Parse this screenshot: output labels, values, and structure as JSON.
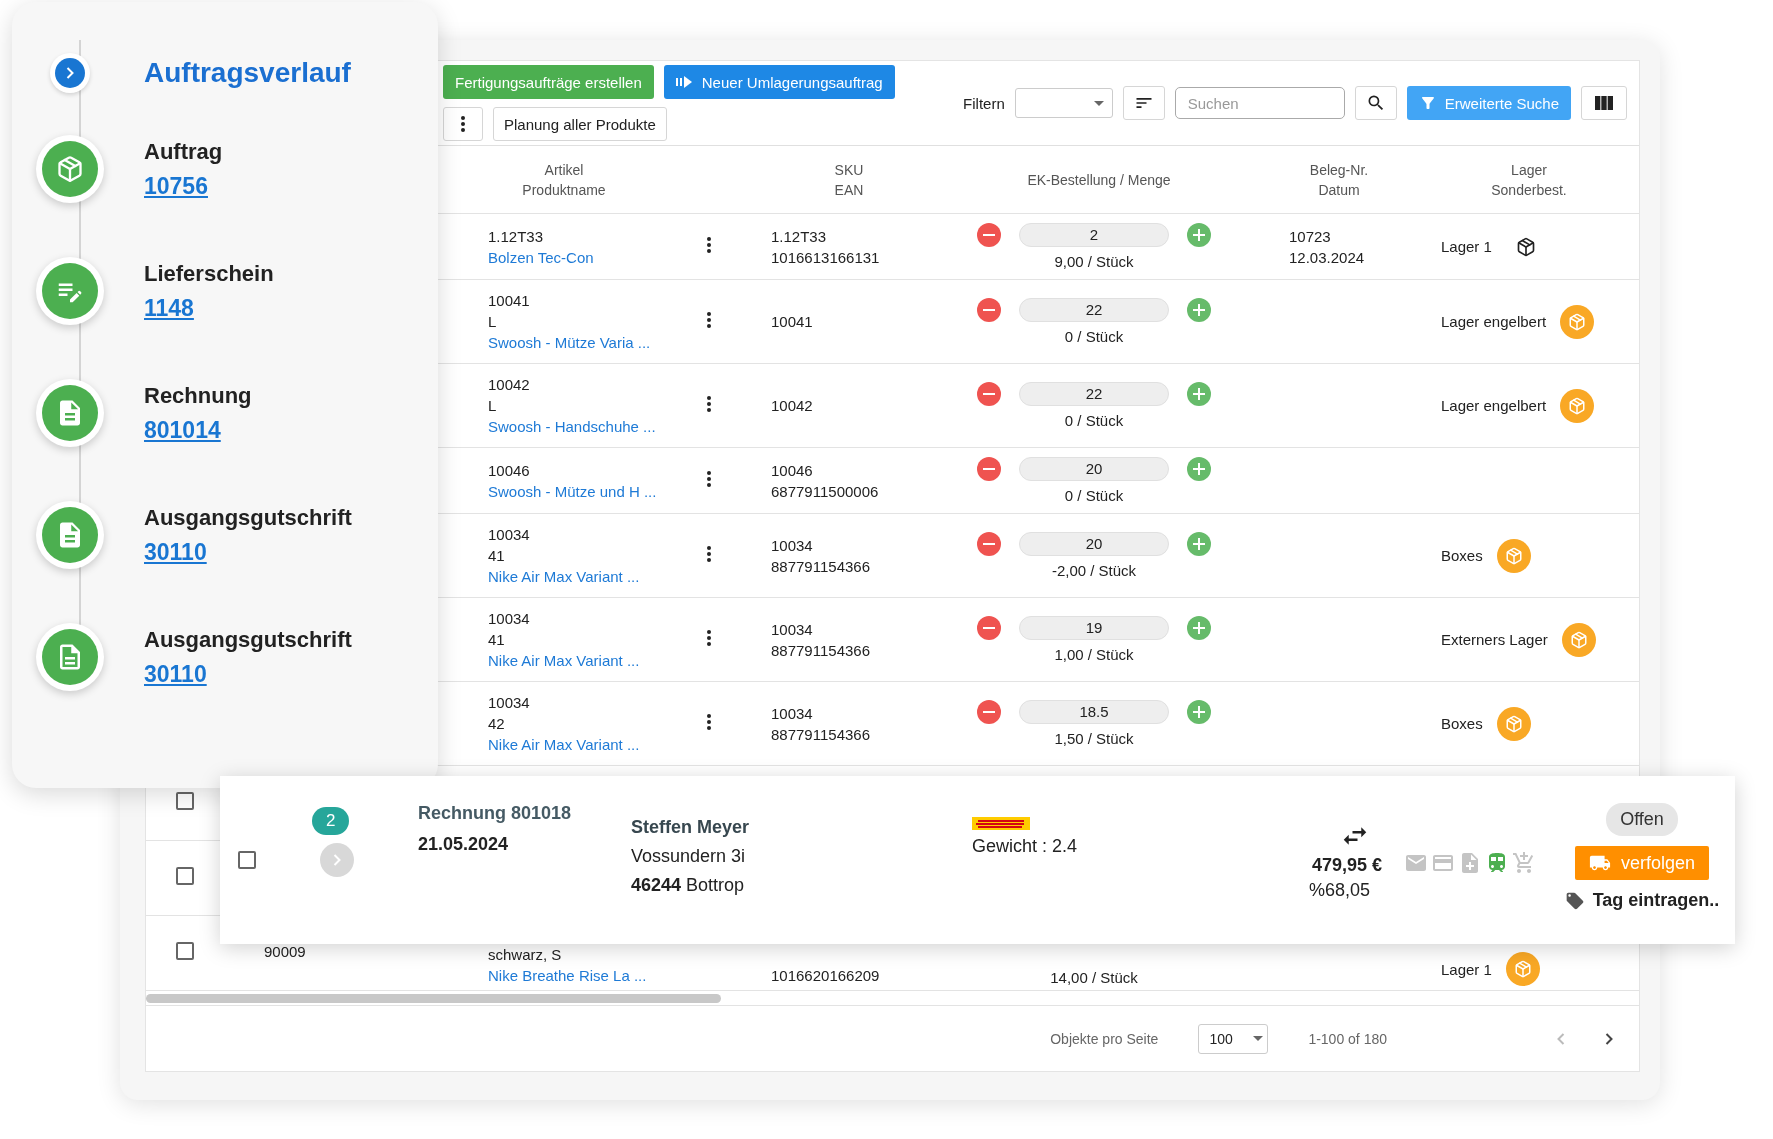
{
  "timeline": {
    "title": "Auftragsverlauf",
    "items": [
      {
        "kind": "order",
        "label": "Auftrag",
        "number": "10756"
      },
      {
        "kind": "delivery",
        "label": "Lieferschein",
        "number": "1148"
      },
      {
        "kind": "invoice",
        "label": "Rechnung",
        "number": "801014"
      },
      {
        "kind": "credit",
        "label": "Ausgangsgutschrift",
        "number": "30110"
      },
      {
        "kind": "credit_note",
        "label": "Ausgangsgutschrift",
        "number": "30110"
      }
    ]
  },
  "toolbar": {
    "primary_buttons": [
      {
        "kind": "production",
        "label": "Fertigungsaufträge erstellen"
      },
      {
        "kind": "transfer",
        "label": "Neuer Umlagerungsauftrag"
      }
    ],
    "planning_button": "Planung aller Produkte",
    "filter_label": "Filtern",
    "search": {
      "placeholder": "Suchen"
    },
    "advanced_search": "Erweiterte Suche"
  },
  "table": {
    "columns": [
      {
        "lines": [
          "Artikel",
          "Produktname"
        ]
      },
      {
        "lines": [
          "SKU",
          "EAN"
        ]
      },
      {
        "lines": [
          "EK-Bestellung / Menge"
        ]
      },
      {
        "lines": [
          "Beleg-Nr.",
          "Datum"
        ]
      },
      {
        "lines": [
          "Lager",
          "Sonderbest."
        ]
      }
    ],
    "rows": [
      {
        "article": [
          "1.12T33"
        ],
        "name": "Bolzen Tec-Con",
        "sku": [
          "1.12T33",
          "1016613166131"
        ],
        "quantity": "2",
        "price": "9,00 / Stück",
        "document": [
          "10723",
          "12.03.2024"
        ],
        "warehouse": {
          "name": "Lager 1",
          "kind": "outline"
        }
      },
      {
        "article": [
          "10041",
          "L"
        ],
        "name": "Swoosh - Mütze Varia ...",
        "sku": [
          "10041"
        ],
        "quantity": "22",
        "price": "0 / Stück",
        "warehouse": {
          "name": "Lager engelbert",
          "kind": "badge"
        }
      },
      {
        "article": [
          "10042",
          "L"
        ],
        "name": "Swoosh - Handschuhe ...",
        "sku": [
          "10042"
        ],
        "quantity": "22",
        "price": "0 / Stück",
        "warehouse": {
          "name": "Lager engelbert",
          "kind": "badge"
        }
      },
      {
        "article": [
          "10046"
        ],
        "name": "Swoosh - Mütze und H ...",
        "sku": [
          "10046",
          "6877911500006"
        ],
        "quantity": "20",
        "price": "0 / Stück"
      },
      {
        "article": [
          "10034",
          "41"
        ],
        "name": "Nike Air Max Variant ...",
        "sku": [
          "10034",
          "887791154366"
        ],
        "quantity": "20",
        "price": "-2,00 / Stück",
        "warehouse": {
          "name": "Boxes",
          "kind": "badge"
        }
      },
      {
        "article": [
          "10034",
          "41"
        ],
        "name": "Nike Air Max Variant ...",
        "sku": [
          "10034",
          "887791154366"
        ],
        "quantity": "19",
        "price": "1,00 / Stück",
        "warehouse": {
          "name": "Externers Lager",
          "kind": "badge"
        }
      },
      {
        "article": [
          "10034",
          "42"
        ],
        "name": "Nike Air Max Variant ...",
        "sku": [
          "10034",
          "887791154366"
        ],
        "quantity": "18.5",
        "price": "1,50 / Stück",
        "warehouse": {
          "name": "Boxes",
          "kind": "badge"
        }
      },
      {
        "checkbox": {
          "checked": false
        }
      },
      {
        "checkbox": {
          "checked": false
        }
      },
      {
        "checkbox": {
          "checked": false
        },
        "lead": "90009",
        "article": [
          "schwarz, S"
        ],
        "name": "Nike Breathe Rise La ...",
        "sku": [
          "1016620166209"
        ],
        "price": "14,00 / Stück",
        "warehouse": {
          "name": "Lager 1",
          "kind": "badge"
        }
      }
    ]
  },
  "pagination": {
    "per_page_label": "Objekte pro Seite",
    "per_page": "100",
    "range": "1-100 of 180",
    "prev_disabled": true
  },
  "order_card": {
    "checked": false,
    "count": "2",
    "document": "Rechnung 801018",
    "date": "21.05.2024",
    "customer": "Steffen Meyer",
    "street": "Vossundern 3i",
    "city": "**46244** Bottrop",
    "weight": "Gewicht : 2.4",
    "amount": "479,95 €",
    "margin": "%68,05",
    "status_icons": [
      {
        "kind": "mail",
        "active": false
      },
      {
        "kind": "card",
        "active": false
      },
      {
        "kind": "document",
        "active": false
      },
      {
        "kind": "train",
        "active": true
      },
      {
        "kind": "cart",
        "active": false
      }
    ],
    "status": "Offen",
    "track_button": "verfolgen",
    "tag_label": "Tag eintragen.."
  }
}
